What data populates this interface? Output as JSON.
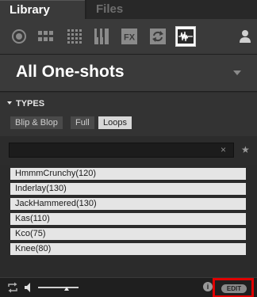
{
  "tabs": {
    "library": "Library",
    "files": "Files"
  },
  "icon_bar": [
    {
      "name": "circle-target-icon"
    },
    {
      "name": "grid-3x2-icon"
    },
    {
      "name": "grid-4x4-icon"
    },
    {
      "name": "piano-keys-icon"
    },
    {
      "name": "fx-icon"
    },
    {
      "name": "loop-arrows-icon"
    },
    {
      "name": "waveform-icon",
      "active": true
    },
    {
      "name": "user-icon"
    }
  ],
  "header": {
    "title": "All One-shots"
  },
  "types": {
    "heading": "TYPES",
    "tags": [
      {
        "label": "Blip & Blop",
        "active": false
      },
      {
        "label": "Full",
        "active": false
      },
      {
        "label": "Loops",
        "active": true
      }
    ]
  },
  "search": {
    "value": "",
    "clear_symbol": "×",
    "star_symbol": "★"
  },
  "results": [
    "HmmmCrunchy(120)",
    "Inderlay(130)",
    "JackHammered(130)",
    "Kas(110)",
    "Kco(75)",
    "Knee(80)"
  ],
  "footer": {
    "volume_level": 0.7,
    "info_symbol": "i",
    "edit_label": "EDIT",
    "highlight_color": "#e00000"
  }
}
